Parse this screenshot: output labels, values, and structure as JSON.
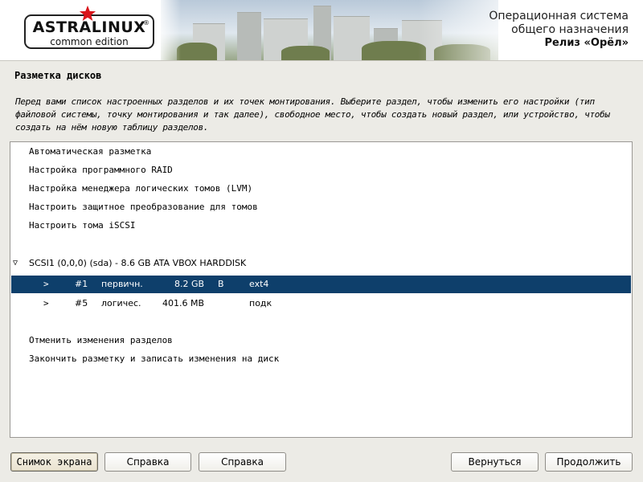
{
  "header": {
    "logo_title": "ASTRALINUX",
    "logo_subtitle": "common edition",
    "logo_registered": "®",
    "os_line1": "Операционная система",
    "os_line2": "общего назначения",
    "release": "Релиз «Орёл»"
  },
  "main": {
    "title": "Разметка дисков",
    "instructions": "Перед вами список настроенных разделов и их точек монтирования. Выберите раздел, чтобы изменить его настройки (тип файловой системы, точку монтирования и так далее), свободное место, чтобы создать новый раздел, или устройство, чтобы создать на нём новую таблицу разделов."
  },
  "list": {
    "actions": [
      "Автоматическая разметка",
      "Настройка программного RAID",
      "Настройка менеджера логических томов (LVM)",
      "Настроить защитное преобразование для томов",
      "Настроить тома iSCSI"
    ],
    "disk": {
      "toggle": "▽",
      "label": "SCSI1 (0,0,0) (sda) - 8.6 GB ATA VBOX HARDDISK"
    },
    "partitions": [
      {
        "arrow": ">",
        "num": "#1",
        "type": "первичн.",
        "size": "8.2 GB",
        "flag": "B",
        "fs": "ext4",
        "selected": true
      },
      {
        "arrow": ">",
        "num": "#5",
        "type": "логичес.",
        "size": "401.6 MB",
        "flag": "",
        "fs": "подк",
        "selected": false
      }
    ],
    "finish": [
      "Отменить изменения разделов",
      "Закончить разметку и записать изменения на диск"
    ]
  },
  "buttons": {
    "screenshot": "Снимок экрана",
    "help1": "Справка",
    "help2": "Справка",
    "back": "Вернуться",
    "continue": "Продолжить"
  },
  "colors": {
    "selection": "#0e3f6b",
    "background": "#ecebe6",
    "star": "#d9151b"
  }
}
